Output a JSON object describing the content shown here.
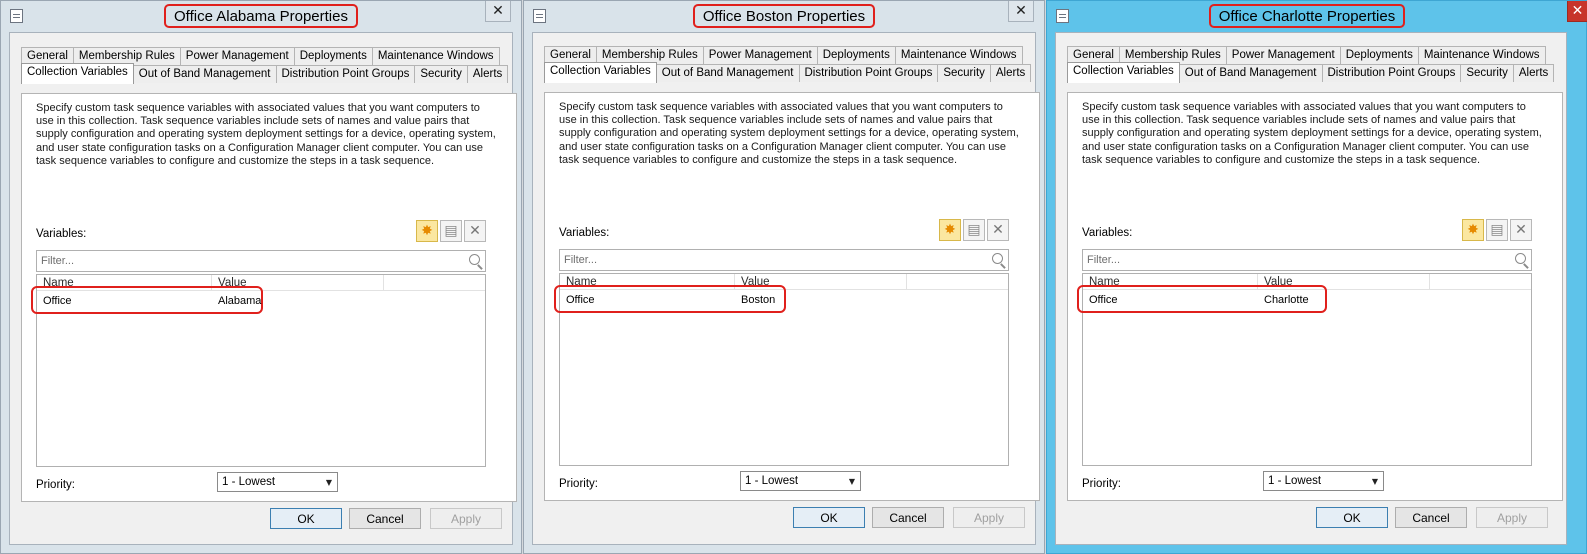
{
  "dialogs": [
    {
      "title": "Office Alabama Properties",
      "close_glyph": "✕",
      "active": false,
      "tabs_row1": [
        "General",
        "Membership Rules",
        "Power Management",
        "Deployments",
        "Maintenance Windows"
      ],
      "tabs_row2": [
        "Collection Variables",
        "Out of Band Management",
        "Distribution Point Groups",
        "Security",
        "Alerts"
      ],
      "selected_tab": "Collection Variables",
      "description": "Specify custom task sequence variables with associated values that you want computers to use in this collection. Task sequence variables include sets of names and value pairs that supply configuration and operating system deployment settings for a device, operating system, and user state configuration tasks on a Configuration Manager client computer. You can use task sequence variables to configure and customize the steps in a task sequence.",
      "variables_label": "Variables:",
      "filter_placeholder": "Filter...",
      "columns": [
        "Name",
        "Value"
      ],
      "rows": [
        {
          "name": "Office",
          "value": "Alabama"
        }
      ],
      "priority_label": "Priority:",
      "priority_value": "1 - Lowest",
      "buttons": {
        "ok": "OK",
        "cancel": "Cancel",
        "apply": "Apply"
      }
    },
    {
      "title": "Office Boston Properties",
      "close_glyph": "✕",
      "active": false,
      "tabs_row1": [
        "General",
        "Membership Rules",
        "Power Management",
        "Deployments",
        "Maintenance Windows"
      ],
      "tabs_row2": [
        "Collection Variables",
        "Out of Band Management",
        "Distribution Point Groups",
        "Security",
        "Alerts"
      ],
      "selected_tab": "Collection Variables",
      "description": "Specify custom task sequence variables with associated values that you want computers to use in this collection. Task sequence variables include sets of names and value pairs that supply configuration and operating system deployment settings for a device, operating system, and user state configuration tasks on a Configuration Manager client computer. You can use task sequence variables to configure and customize the steps in a task sequence.",
      "variables_label": "Variables:",
      "filter_placeholder": "Filter...",
      "columns": [
        "Name",
        "Value"
      ],
      "rows": [
        {
          "name": "Office",
          "value": "Boston"
        }
      ],
      "priority_label": "Priority:",
      "priority_value": "1 - Lowest",
      "buttons": {
        "ok": "OK",
        "cancel": "Cancel",
        "apply": "Apply"
      }
    },
    {
      "title": "Office Charlotte Properties",
      "close_glyph": "✕",
      "active": true,
      "tabs_row1": [
        "General",
        "Membership Rules",
        "Power Management",
        "Deployments",
        "Maintenance Windows"
      ],
      "tabs_row2": [
        "Collection Variables",
        "Out of Band Management",
        "Distribution Point Groups",
        "Security",
        "Alerts"
      ],
      "selected_tab": "Collection Variables",
      "description": "Specify custom task sequence variables with associated values that you want computers to use in this collection. Task sequence variables include sets of names and value pairs that supply configuration and operating system deployment settings for a device, operating system, and user state configuration tasks on a Configuration Manager client computer. You can use task sequence variables to configure and customize the steps in a task sequence.",
      "variables_label": "Variables:",
      "filter_placeholder": "Filter...",
      "columns": [
        "Name",
        "Value"
      ],
      "rows": [
        {
          "name": "Office",
          "value": "Charlotte"
        }
      ],
      "priority_label": "Priority:",
      "priority_value": "1 - Lowest",
      "buttons": {
        "ok": "OK",
        "cancel": "Cancel",
        "apply": "Apply"
      }
    }
  ],
  "icons": {
    "window": "dialog-icon",
    "new": "sunburst-new-icon",
    "properties": "properties-icon",
    "delete": "delete-x-icon",
    "search": "search-icon",
    "dropdown": "chevron-down-icon"
  },
  "colors": {
    "active_frame": "#5ec3ea",
    "inactive_frame": "#d9e3ea",
    "highlight_annotation": "#e0201c",
    "close_active": "#c7352a"
  }
}
